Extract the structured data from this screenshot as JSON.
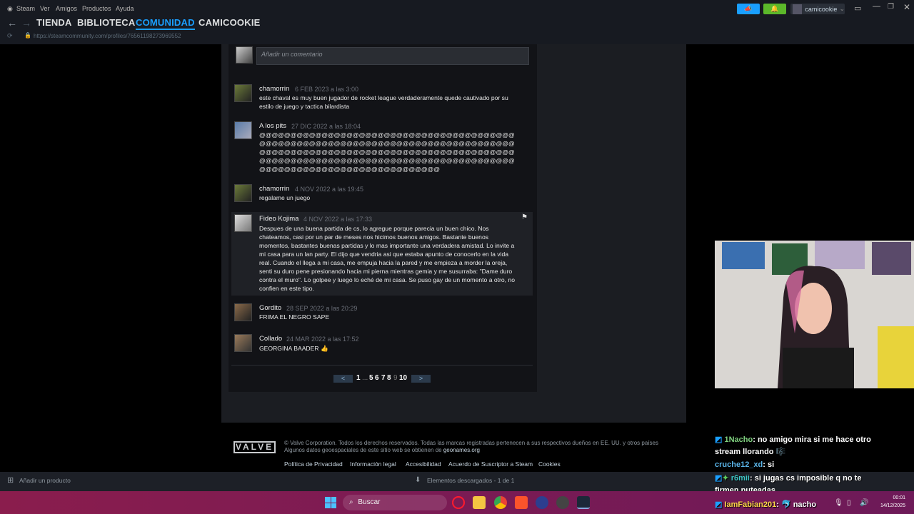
{
  "menu": {
    "steam": "Steam",
    "ver": "Ver",
    "amigos": "Amigos",
    "productos": "Productos",
    "ayuda": "Ayuda"
  },
  "account": {
    "name": "camicookie"
  },
  "nav": {
    "tienda": "TIENDA",
    "biblioteca": "BIBLIOTECA",
    "comunidad": "COMUNIDAD",
    "user": "CAMICOOKIE",
    "active": "COMUNIDAD"
  },
  "url": "https://steamcommunity.com/profiles/76561198273969552",
  "comment_input": {
    "placeholder": "Añadir un comentario"
  },
  "comments": [
    {
      "author": "chamorrin",
      "date": "6 FEB 2023 a las 3:00",
      "text": "este chaval es muy buen jugador de rocket league verdaderamente quede cautivado por su estilo de juego y tactica bilardista"
    },
    {
      "author": "A los pits",
      "date": "27 DIC 2022 a las 18:04",
      "text": "@@@@@@@@@@@@@@@@@@@@@@@@@@@@@@@@@@@@@@@@@@@@@@@@@@@@@@@@@@@@@@@@@@@@@@@@@@@@@@@@@@@@@@@@@@@@@@@@@@@@@@@@@@@@@@@@@@@@@@@@@@@@@@@@@@@@@@@@@@@@@@@@@@@@@@@@@@@@@@@@@@@@@@@@@@@@@@@@@@@@@@@@@@@@@@@@@"
    },
    {
      "author": "chamorrin",
      "date": "4 NOV 2022 a las 19:45",
      "text": "regalame un juego"
    },
    {
      "author": "Fideo Kojima",
      "date": "4 NOV 2022 a las 17:33",
      "text": "Despues de una buena partida de cs, lo agregue porque parecia un buen chico. Nos chateamos, casi por un par de meses nos hicimos buenos amigos. Bastante buenos momentos, bastantes buenas partidas y lo mas importante una verdadera amistad. Lo invite a mi casa para un lan party. El dijo que vendria asi que estaba apunto de conocerlo en la vida real. Cuando el llega a mi casa, me empuja hacia la pared y me empieza a morder la oreja, senti su duro pene presionando hacia mi pierna mientras gemia y me susurraba: \"Dame duro contra el muro\". Lo golpee y luego lo eché de mi casa. Se puso gay de un momento a otro, no confien en este tipo."
    },
    {
      "author": "Gordito",
      "date": "28 SEP 2022 a las 20:29",
      "text": "FRIMA EL NEGRO SAPE"
    },
    {
      "author": "Collado",
      "date": "24 MAR 2022 a las 17:52",
      "text": "GEORGINA BAADER 👍"
    }
  ],
  "pager": {
    "prev": "<",
    "next": ">",
    "p1": "1",
    "ellipsis": "...",
    "p5": "5",
    "p6": "6",
    "p7": "7",
    "p8": "8",
    "p9": "9",
    "p10": "10",
    "current": "9"
  },
  "footer": {
    "logo": "VALVE",
    "line1": "© Valve Corporation. Todos los derechos reservados. Todas las marcas registradas pertenecen a sus respectivos dueños en EE. UU. y otros países",
    "line2": "Algunos datos geoespaciales de este sitio web se obtienen de ",
    "geonames": "geonames.org",
    "links": [
      "Política de Privacidad",
      "Información legal",
      "Accesibilidad",
      "Acuerdo de Suscriptor a Steam",
      "Cookies"
    ]
  },
  "statusbar": {
    "add_product": "Añadir un producto",
    "downloads": "Elementos descargados - 1 de 1"
  },
  "chat": [
    {
      "user": "1Nacho",
      "text": ": no amigo mira si me hace otro stream llorando 🎼"
    },
    {
      "user": "cruche12_xd",
      "text": ": si"
    },
    {
      "user": "r6mii",
      "text": ": si jugas cs imposible q no te firmen puteadas"
    },
    {
      "user": "IamFabian201",
      "text": ": 🐬 nacho"
    }
  ],
  "taskbar": {
    "search": "Buscar",
    "time": "00:01",
    "date": "14/12/2025"
  },
  "colors": {
    "accent": "#1a9fff",
    "topbar": "#171a21",
    "taskbar": "#8a1d4d"
  }
}
